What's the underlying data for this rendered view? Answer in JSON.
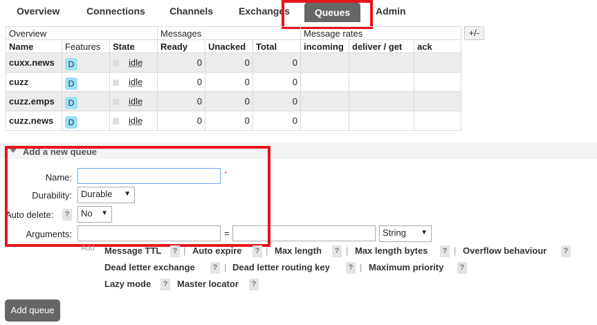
{
  "nav": {
    "tabs": [
      "Overview",
      "Connections",
      "Channels",
      "Exchanges",
      "Queues",
      "Admin"
    ],
    "active": "Queues"
  },
  "table": {
    "group_headers": [
      "Overview",
      "Messages",
      "Message rates"
    ],
    "columns": [
      "Name",
      "Features",
      "State",
      "Ready",
      "Unacked",
      "Total",
      "incoming",
      "deliver / get",
      "ack"
    ],
    "plus_minus": "+/-",
    "rows": [
      {
        "name": "cuxx.news",
        "feature": "D",
        "state": "idle",
        "ready": "0",
        "unacked": "0",
        "total": "0"
      },
      {
        "name": "cuzz",
        "feature": "D",
        "state": "idle",
        "ready": "0",
        "unacked": "0",
        "total": "0"
      },
      {
        "name": "cuzz.emps",
        "feature": "D",
        "state": "idle",
        "ready": "0",
        "unacked": "0",
        "total": "0"
      },
      {
        "name": "cuzz.news",
        "feature": "D",
        "state": "idle",
        "ready": "0",
        "unacked": "0",
        "total": "0"
      }
    ]
  },
  "add_queue": {
    "section_title": "Add a new queue",
    "name_label": "Name:",
    "required_mark": "*",
    "durability_label": "Durability:",
    "durability_value": "Durable",
    "auto_delete_label": "Auto delete:",
    "auto_delete_value": "No",
    "arguments_label": "Arguments:",
    "equals": "=",
    "type_value": "String",
    "add_text": "Add",
    "help_mark": "?",
    "separator": "|",
    "arg_links": [
      "Message TTL",
      "Auto expire",
      "Max length",
      "Max length bytes",
      "Overflow behaviour",
      "Dead letter exchange",
      "Dead letter routing key",
      "Maximum priority",
      "Lazy mode",
      "Master locator"
    ],
    "submit_label": "Add queue"
  },
  "colors": {
    "highlight": "#e8141b",
    "active_tab": "#666666",
    "badge": "#9ddff5"
  }
}
